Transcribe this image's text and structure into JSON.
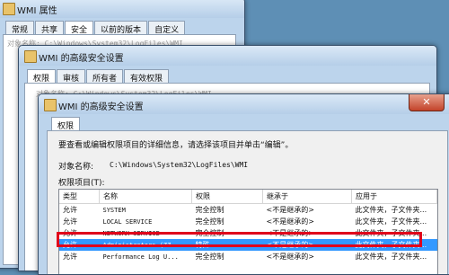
{
  "win1": {
    "title": "WMI 属性",
    "tabs": [
      "常规",
      "共享",
      "安全",
      "以前的版本",
      "自定义"
    ],
    "faded_text": "对象名称:  C:\\Windows\\System32\\LogFiles\\WMI"
  },
  "win2": {
    "title": "WMI 的高级安全设置",
    "tabs": [
      "权限",
      "审核",
      "所有者",
      "有效权限"
    ],
    "faded_text": "对象名称:  C:\\Windows\\System32\\LogFiles\\WMI"
  },
  "win3": {
    "title": "WMI 的高级安全设置",
    "tab": "权限",
    "instruction": "要查看或编辑权限项目的详细信息，请选择该项目并单击“编辑”。",
    "object_label": "对象名称:",
    "object_path": "C:\\Windows\\System32\\LogFiles\\WMI",
    "entries_label": "权限项目(T):",
    "columns": [
      "类型",
      "名称",
      "权限",
      "继承于",
      "应用于"
    ],
    "rows": [
      {
        "type": "允许",
        "name": "SYSTEM",
        "perm": "完全控制",
        "inherit": "<不是继承的>",
        "apply": "此文件夹，子文件夹..."
      },
      {
        "type": "允许",
        "name": "LOCAL SERVICE",
        "perm": "完全控制",
        "inherit": "<不是继承的>",
        "apply": "此文件夹，子文件夹..."
      },
      {
        "type": "允许",
        "name": "NETWORK SERVICE",
        "perm": "完全控制",
        "inherit": "<不是继承的>",
        "apply": "此文件夹，子文件夹..."
      },
      {
        "type": "允许",
        "name": "Administrators (ZZ...",
        "perm": "特殊",
        "inherit": "<不是继承的>",
        "apply": "此文件夹，子文件夹..."
      },
      {
        "type": "允许",
        "name": "Performance Log U...",
        "perm": "完全控制",
        "inherit": "<不是继承的>",
        "apply": "此文件夹，子文件夹..."
      }
    ],
    "selected_row": 3,
    "highlight_color": "#e0001b",
    "selection_color": "#3399ff"
  },
  "desktop_bg": "#5e8fb5"
}
